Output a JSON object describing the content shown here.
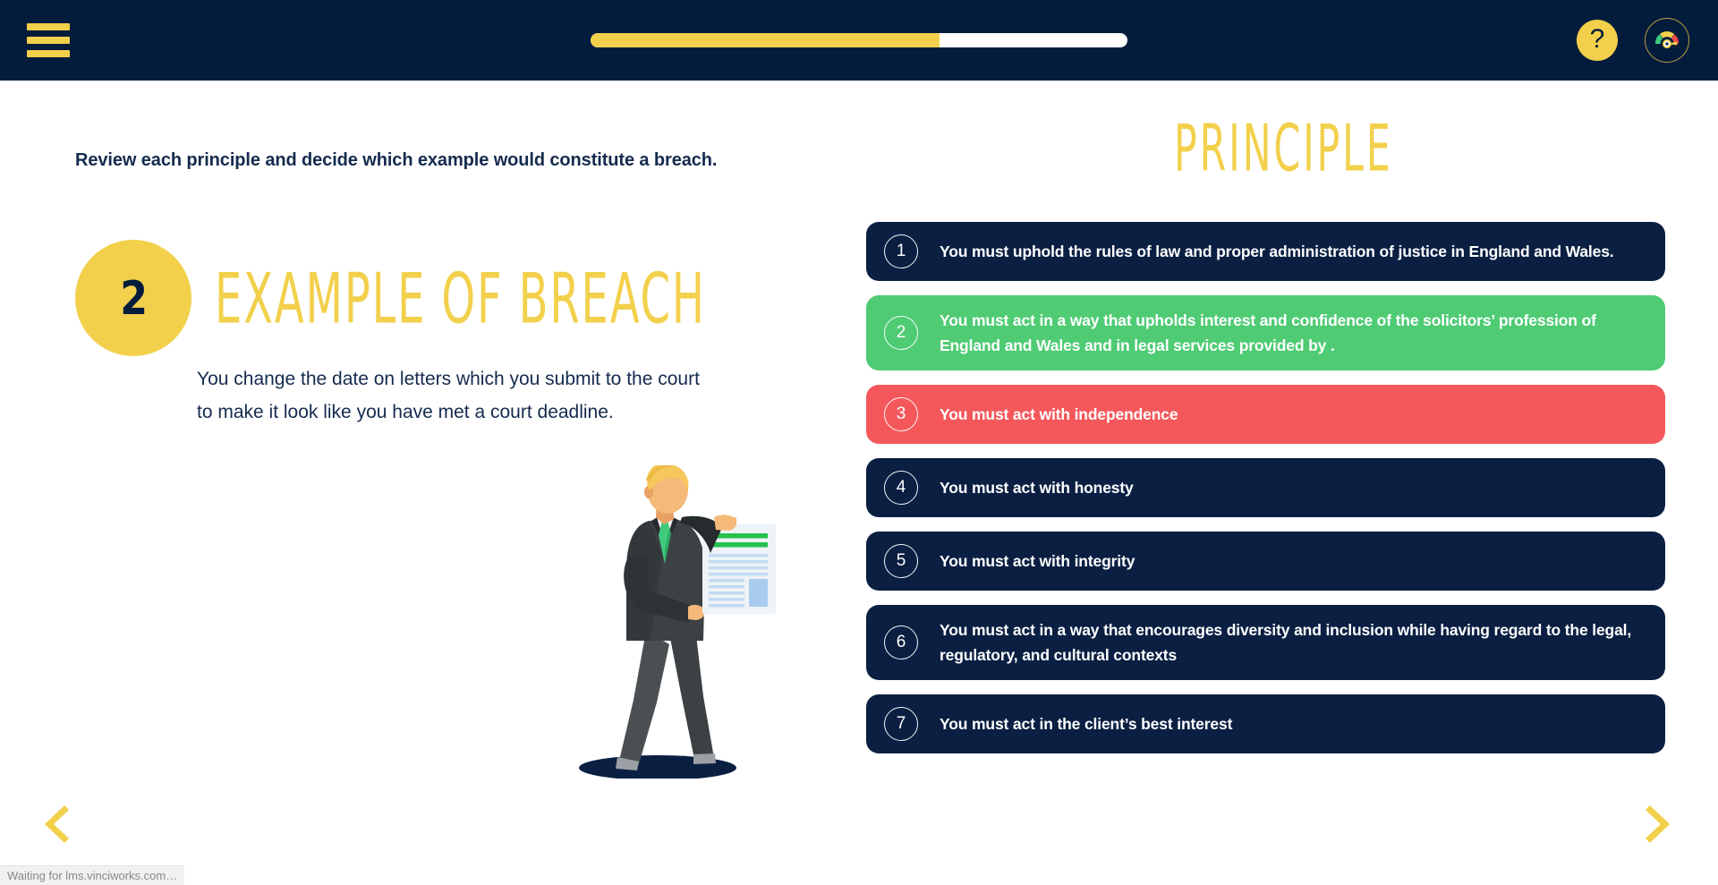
{
  "header": {
    "menu_label": "menu",
    "progress_percent": 65,
    "help_label": "?",
    "gauge_label": "progress-gauge"
  },
  "left": {
    "intro": "Review each principle and decide which example would constitute a breach.",
    "badge_number": "2",
    "section_title": "EXAMPLE OF BREACH",
    "body": "You change the date on letters which you submit to the court to make it look like you have met a court deadline.",
    "illustration_name": "businessman-holding-document"
  },
  "right": {
    "title": "PRINCIPLE",
    "items": [
      {
        "num": "1",
        "text": "You must uphold the rules of law and proper administration of justice in England and Wales.",
        "state": "navy"
      },
      {
        "num": "2",
        "text": "You must act in a way that upholds interest and confidence of the solicitors’ profession of England and Wales and in legal services provided by .",
        "state": "green"
      },
      {
        "num": "3",
        "text": "You must act with independence",
        "state": "red"
      },
      {
        "num": "4",
        "text": "You must act with honesty",
        "state": "navy"
      },
      {
        "num": "5",
        "text": "You must act with integrity",
        "state": "navy"
      },
      {
        "num": "6",
        "text": "You must act in a way that encourages diversity and inclusion while having regard to the legal, regulatory, and cultural contexts",
        "state": "navy"
      },
      {
        "num": "7",
        "text": "You must act in the client’s best interest",
        "state": "navy"
      }
    ]
  },
  "nav": {
    "prev_label": "previous",
    "next_label": "next"
  },
  "status": {
    "text": "Waiting for lms.vinciworks.com…"
  },
  "colors": {
    "navy": "#041C3C",
    "panel_navy": "#0A1F42",
    "yellow": "#F2D04B",
    "green": "#4FCB74",
    "red": "#F4585B",
    "text_navy": "#152B4E",
    "white": "#FFFFFF"
  }
}
